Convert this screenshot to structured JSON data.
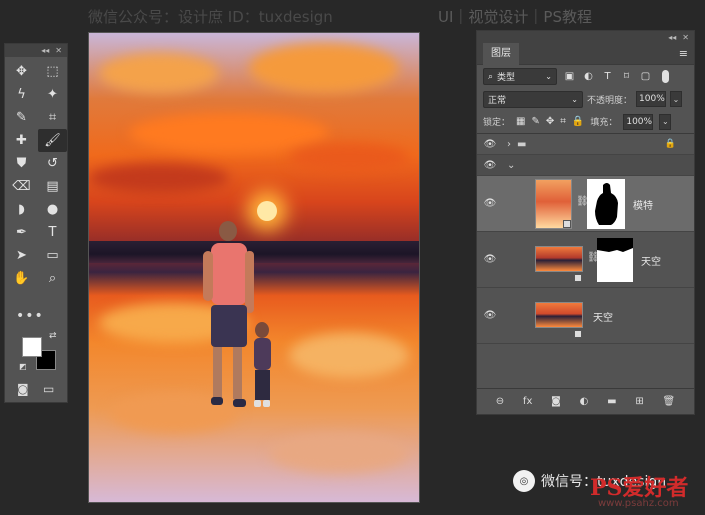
{
  "watermark": {
    "top": "微信公众号：设计庶  ID：tuxdesign",
    "top_right": "UI｜视觉设计｜PS教程",
    "bottom": "微信号：tuxdesign",
    "brand": "PS爱好者",
    "site": "www.psahz.com"
  },
  "tools": {
    "collapse": "◂◂",
    "close": "✕",
    "items": [
      "move-icon",
      "marquee-icon",
      "lasso-icon",
      "magic-wand-icon",
      "eyedropper-icon",
      "crop-icon",
      "healing-icon",
      "brush-icon",
      "stamp-icon",
      "history-brush-icon",
      "eraser-icon",
      "gradient-icon",
      "blur-icon",
      "dodge-icon",
      "pen-icon",
      "type-icon",
      "path-select-icon",
      "rectangle-icon",
      "hand-icon",
      "zoom-icon"
    ],
    "glyphs": [
      "✥",
      "⬚",
      "ϟ",
      "✦",
      "✎",
      "⌗",
      "✚",
      "🖌",
      "⛊",
      "↺",
      "⌫",
      "▤",
      "◗",
      "●",
      "✒",
      "T",
      "➤",
      "▭",
      "✋",
      "⌕"
    ],
    "active_index": 7,
    "more": "•••",
    "foreground": "#ffffff",
    "background": "#000000"
  },
  "layers_panel": {
    "collapse": "◂◂",
    "close": "✕",
    "tab": "图层",
    "menu": "≡",
    "kind_icon": "⌕",
    "kind": "类型",
    "blend_mode": "正常",
    "opacity_label": "不透明度：",
    "opacity": "100%",
    "lock_label": "锁定：",
    "fill_label": "填充：",
    "fill": "100%",
    "layers": [
      {
        "name": "",
        "type": "group",
        "collapsed": true
      },
      {
        "name": "",
        "type": "group",
        "collapsed": false
      },
      {
        "name": "模特",
        "type": "layer",
        "has_mask": true,
        "selected": true
      },
      {
        "name": "天空",
        "type": "layer",
        "has_mask": true,
        "selected": false
      },
      {
        "name": "天空",
        "type": "layer",
        "has_mask": false,
        "selected": false
      }
    ],
    "footer": [
      "⊖",
      "fx",
      "◙",
      "◐",
      "▬",
      "⊞",
      "🗑"
    ]
  },
  "colors": {
    "panel": "#535353",
    "panel_dark": "#424242",
    "app_bg": "#282828",
    "selected_row": "#6b6b6b"
  }
}
